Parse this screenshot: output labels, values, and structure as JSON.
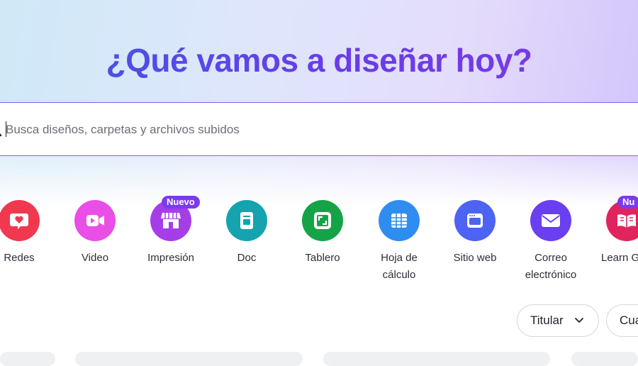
{
  "hero": {
    "title": "¿Qué vamos a diseñar hoy?"
  },
  "search": {
    "placeholder": "Busca diseños, carpetas y archivos subidos"
  },
  "categories": [
    {
      "label": "Redes",
      "icon": "heart-chat-icon",
      "color": "#f0394f"
    },
    {
      "label": "Video",
      "icon": "video-camera-icon",
      "color": "#e94ee6"
    },
    {
      "label": "Impresión",
      "icon": "storefront-icon",
      "color": "#a63ee8",
      "badge": "Nuevo"
    },
    {
      "label": "Doc",
      "icon": "document-icon",
      "color": "#15a3b0"
    },
    {
      "label": "Tablero",
      "icon": "whiteboard-icon",
      "color": "#14a447"
    },
    {
      "label": "Hoja de cálculo",
      "icon": "spreadsheet-icon",
      "color": "#2f8df0"
    },
    {
      "label": "Sitio web",
      "icon": "browser-window-icon",
      "color": "#4d63f3"
    },
    {
      "label": "Correo electrónico",
      "icon": "envelope-icon",
      "color": "#6a3ff0"
    },
    {
      "label": "Learn G",
      "icon": "book-icon",
      "color": "#e0245e",
      "badge": "Nu"
    }
  ],
  "filters": {
    "sort_label": "Titular",
    "next_label": "Cua"
  }
}
